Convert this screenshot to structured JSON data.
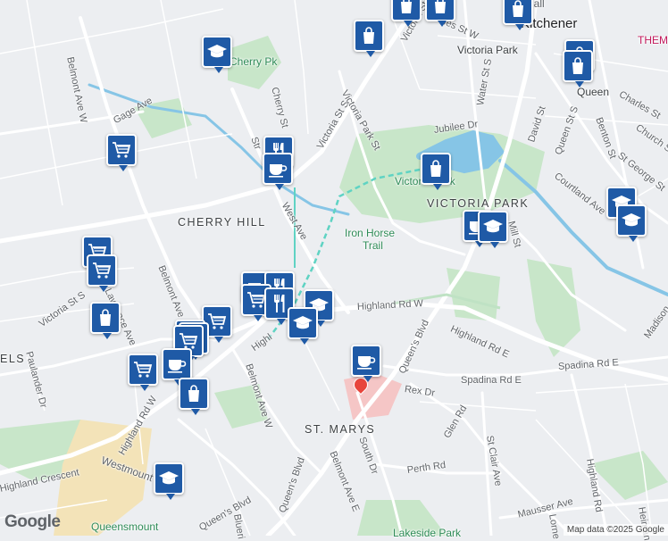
{
  "map": {
    "attribution": "Map data ©2025 Google",
    "logo": "Google",
    "colors": {
      "background": "#eceef1",
      "park": "#c8e6c9",
      "water": "#86c5e6",
      "pin": "#1f5aa6",
      "trail": "#5fd3c3",
      "campus": "#f3e3b8",
      "hospital": "#f5c6c6"
    }
  },
  "labels": {
    "kitchener": "Kitchener",
    "city_hall": "City Hall",
    "themuseum": "THEM",
    "victoria_park_top": "Victoria Park",
    "queen_top": "Queen",
    "cherry_pk": "Cherry Pk",
    "victoria_park_park": "Victoria Park",
    "victoria_park_hood": "VICTORIA PARK",
    "cherry_hill": "CHERRY HILL",
    "iron_horse_1": "Iron Horse",
    "iron_horse_2": "Trail",
    "st_marys": "ST. MARYS",
    "queensmount": "Queensmount",
    "lakeside_park": "Lakeside Park",
    "els": "ELS"
  },
  "roads": {
    "belmont_w_top": "Belmont Ave W",
    "gage": "Gage Ave",
    "cherry_st": "Cherry St",
    "victoria_s_top": "Victoria St S",
    "victoria_park_st": "Victoria Park St",
    "victoria_n": "Victoria St N",
    "charles_w": "Charles St W",
    "water_s": "Water St S",
    "jubilee": "Jubilee Dr",
    "david": "David St",
    "queen_s": "Queen St S",
    "benton": "Benton St",
    "charles_e": "Charles St",
    "church": "Church S",
    "st_george": "St George St",
    "courtland": "Courtland Ave",
    "mill": "Mill St",
    "madison": "Madison",
    "west_ave": "West Ave",
    "strange": "Str",
    "belmont_ave_mid": "Belmont Ave",
    "victoria_s_left": "Victoria St S",
    "lawrence": "Lawrence Ave",
    "paulander": "Paulander Dr",
    "highland_w": "Highland Rd W",
    "highland_e": "Highland Rd E",
    "queens_blvd_e": "Queen's Blvd",
    "queens_blvd_mid": "Queen's Blvd",
    "queens_blvd_low": "Queen's Blvd",
    "spadina_e1": "Spadina Rd E",
    "spadina_e2": "Spadina Rd E",
    "rex": "Rex Dr",
    "glen": "Glen Rd",
    "st_clair": "St Clair Ave",
    "perth": "Perth Rd",
    "south": "South Dr",
    "belmont_e": "Belmont Ave E",
    "belmont_w_mid": "Belmont Ave W",
    "highland_w_left": "Highland Rd W",
    "highl_mid": "Highl",
    "westmount": "Westmount",
    "highland_crescent": "Highland Crescent",
    "highland_rd_right": "Highland Rd",
    "mausser": "Mausser Ave",
    "lorne": "Lorne",
    "blueri": "Blueri",
    "heiman": "Heiman",
    "uelph": "ue"
  },
  "pins": [
    {
      "name": "school-pin-cherry",
      "icon": "school"
    },
    {
      "name": "shopping-pin-top-a",
      "icon": "shopping"
    },
    {
      "name": "shopping-pin-top-b",
      "icon": "shopping"
    },
    {
      "name": "shopping-pin-victoria-st",
      "icon": "shopping"
    },
    {
      "name": "shopping-pin-kitchener",
      "icon": "shopping"
    },
    {
      "name": "shopping-pin-queen",
      "icon": "shopping"
    },
    {
      "name": "shopping-pin-queen-b",
      "icon": "shopping"
    },
    {
      "name": "grocery-pin-gage",
      "icon": "grocery"
    },
    {
      "name": "restaurant-pin-west-ave",
      "icon": "restaurant"
    },
    {
      "name": "cafe-pin-west-ave",
      "icon": "cafe"
    },
    {
      "name": "shopping-pin-victoria-park",
      "icon": "shopping"
    },
    {
      "name": "school-pin-courtland-a",
      "icon": "school"
    },
    {
      "name": "school-pin-courtland-b",
      "icon": "school"
    },
    {
      "name": "cafe-pin-queens-blvd",
      "icon": "cafe"
    },
    {
      "name": "school-pin-queens-blvd",
      "icon": "school"
    },
    {
      "name": "grocery-pin-victoria-a",
      "icon": "grocery"
    },
    {
      "name": "grocery-pin-victoria-b",
      "icon": "grocery"
    },
    {
      "name": "shopping-pin-lawrence",
      "icon": "shopping"
    },
    {
      "name": "grocery-pin-belmont-a",
      "icon": "grocery"
    },
    {
      "name": "cafe-pin-belmont",
      "icon": "cafe"
    },
    {
      "name": "restaurant-pin-belmont-a",
      "icon": "restaurant"
    },
    {
      "name": "grocery-pin-belmont-b",
      "icon": "grocery"
    },
    {
      "name": "restaurant-pin-belmont-b",
      "icon": "restaurant"
    },
    {
      "name": "school-pin-belmont",
      "icon": "school"
    },
    {
      "name": "school-pin-highland",
      "icon": "school"
    },
    {
      "name": "grocery-pin-highland-a",
      "icon": "grocery"
    },
    {
      "name": "grocery-pin-highland-b",
      "icon": "grocery"
    },
    {
      "name": "grocery-pin-highland-c",
      "icon": "grocery"
    },
    {
      "name": "cafe-pin-highland",
      "icon": "cafe"
    },
    {
      "name": "grocery-pin-highland-d",
      "icon": "grocery"
    },
    {
      "name": "shopping-pin-highland",
      "icon": "shopping"
    },
    {
      "name": "cafe-pin-st-marys",
      "icon": "cafe"
    },
    {
      "name": "school-pin-westmount",
      "icon": "school"
    }
  ]
}
